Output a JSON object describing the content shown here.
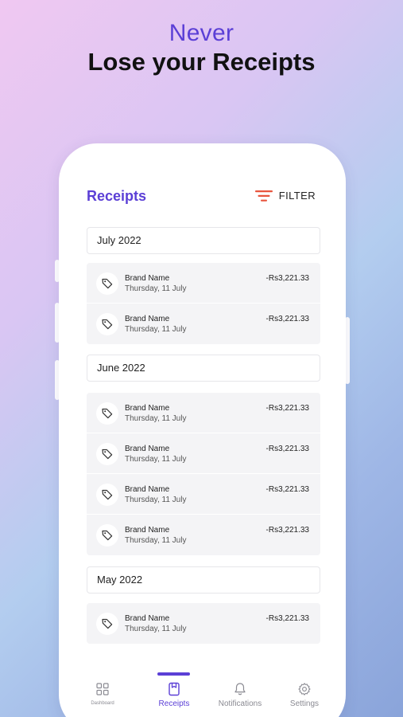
{
  "headline": {
    "line1": "Never",
    "line2": "Lose your Receipts"
  },
  "app": {
    "title": "Receipts",
    "filter_label": "FILTER",
    "colors": {
      "accent": "#5b3fd6",
      "filter_icon": "#e8553d"
    },
    "groups": [
      {
        "month": "July 2022",
        "items": [
          {
            "brand": "Brand Name",
            "date": "Thursday, 11 July",
            "amount": "-Rs3,221.33"
          },
          {
            "brand": "Brand Name",
            "date": "Thursday, 11 July",
            "amount": "-Rs3,221.33"
          }
        ]
      },
      {
        "month": "June 2022",
        "items": [
          {
            "brand": "Brand Name",
            "date": "Thursday, 11 July",
            "amount": "-Rs3,221.33"
          },
          {
            "brand": "Brand Name",
            "date": "Thursday, 11 July",
            "amount": "-Rs3,221.33"
          },
          {
            "brand": "Brand Name",
            "date": "Thursday, 11 July",
            "amount": "-Rs3,221.33"
          },
          {
            "brand": "Brand Name",
            "date": "Thursday, 11 July",
            "amount": "-Rs3,221.33"
          }
        ]
      },
      {
        "month": "May 2022",
        "items": [
          {
            "brand": "Brand Name",
            "date": "Thursday, 11 July",
            "amount": "-Rs3,221.33"
          }
        ]
      }
    ],
    "nav": [
      {
        "label": "Dashboard",
        "icon": "grid-icon",
        "active": false
      },
      {
        "label": "Receipts",
        "icon": "receipt-icon",
        "active": true
      },
      {
        "label": "Notifications",
        "icon": "bell-icon",
        "active": false
      },
      {
        "label": "Settings",
        "icon": "gear-icon",
        "active": false
      }
    ]
  }
}
